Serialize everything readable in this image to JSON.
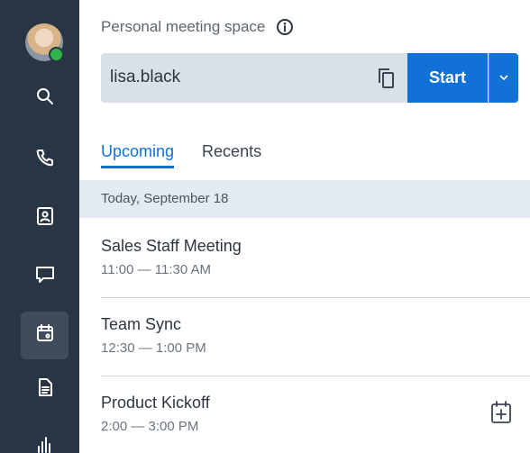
{
  "header": {
    "pms_label": "Personal meeting space"
  },
  "meeting_field": {
    "id": "lisa.black"
  },
  "start_button": {
    "label": "Start"
  },
  "tabs": [
    {
      "label": "Upcoming",
      "selected": true
    },
    {
      "label": "Recents",
      "selected": false
    }
  ],
  "date_header": "Today, September 18",
  "meetings": [
    {
      "title": "Sales Staff Meeting",
      "time": "11:00 — 11:30 AM"
    },
    {
      "title": "Team Sync",
      "time": "12:30 — 1:00 PM"
    },
    {
      "title": "Product Kickoff",
      "time": "2:00 — 3:00 PM"
    }
  ],
  "sidebar": {
    "items": [
      {
        "icon": "search-icon"
      },
      {
        "icon": "phone-icon"
      },
      {
        "icon": "contacts-icon"
      },
      {
        "icon": "chat-icon"
      },
      {
        "icon": "calendar-icon",
        "active": true
      },
      {
        "icon": "document-icon"
      },
      {
        "icon": "analytics-icon"
      }
    ]
  },
  "colors": {
    "sidebar_bg": "#283544",
    "accent": "#1171d6",
    "presence": "#2fb34a"
  }
}
